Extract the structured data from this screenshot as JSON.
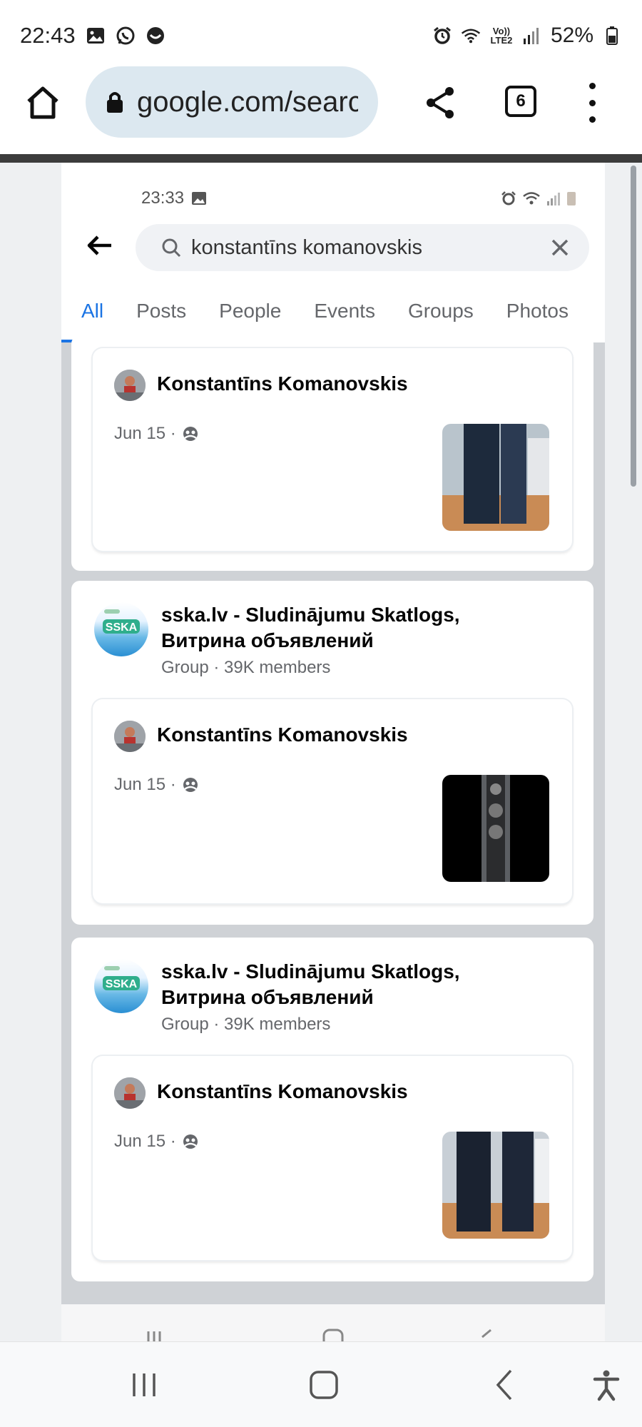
{
  "os_status": {
    "time": "22:43",
    "battery": "52%",
    "network_label": "Vo)) LTE2"
  },
  "browser": {
    "url": "google.com/search",
    "tab_count": "6"
  },
  "embedded": {
    "status_time": "23:33",
    "search": {
      "query": "konstantīns komanovskis"
    },
    "tabs": [
      {
        "label": "All",
        "active": true
      },
      {
        "label": "Posts",
        "active": false
      },
      {
        "label": "People",
        "active": false
      },
      {
        "label": "Events",
        "active": false
      },
      {
        "label": "Groups",
        "active": false
      },
      {
        "label": "Photos",
        "active": false
      }
    ],
    "results": [
      {
        "group": null,
        "post": {
          "author": "Konstantīns Komanovskis",
          "date": "Jun 15 ·",
          "thumb": "speakers-blue"
        }
      },
      {
        "group": {
          "name_line1": "sska.lv - Sludinājumu Skatlogs,",
          "name_line2": "Витрина объявлений",
          "meta": "Group · 39K members",
          "logo_text": "SSKA"
        },
        "post": {
          "author": "Konstantīns Komanovskis",
          "date": "Jun 15 ·",
          "thumb": "speaker-black"
        }
      },
      {
        "group": {
          "name_line1": "sska.lv - Sludinājumu Skatlogs,",
          "name_line2": "Витрина объявлений",
          "meta": "Group · 39K members",
          "logo_text": "SSKA"
        },
        "post": {
          "author": "Konstantīns Komanovskis",
          "date": "Jun 15 ·",
          "thumb": "speakers-dark"
        }
      }
    ]
  },
  "icons": {
    "home": "home-icon",
    "lock": "lock-icon",
    "share": "share-icon",
    "menu": "more-vert-icon",
    "audience": "public-group-icon"
  }
}
